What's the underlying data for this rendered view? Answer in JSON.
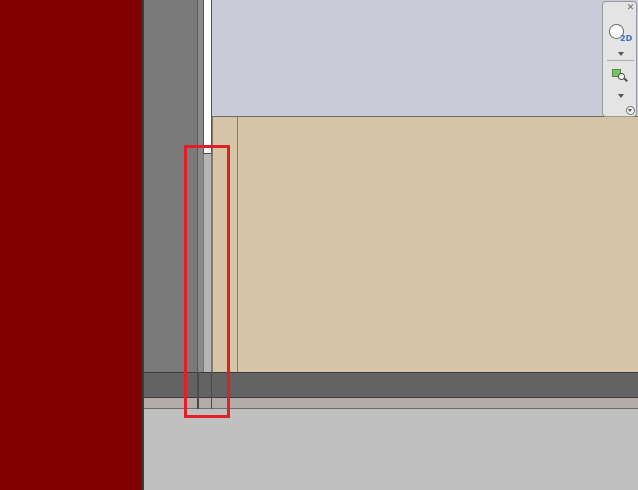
{
  "navigation_bar": {
    "close_glyph": "✕",
    "steering_wheel": {
      "icon": "steering-wheel-icon",
      "label": "2D"
    },
    "zoom_tool": {
      "icon": "zoom-icon"
    },
    "colors": {
      "wheel_label": "#3a6fc4",
      "zoom_square": "#7fbf6a"
    }
  },
  "canvas": {
    "colors": {
      "red_panel": "#800000",
      "gray_wall": "#7a7a7a",
      "sky": "#c9ccd8",
      "beige": "#d6c4a6",
      "dark_band": "#636363",
      "lower_area": "#c0c0c0",
      "highlight": "#e21e26"
    }
  }
}
